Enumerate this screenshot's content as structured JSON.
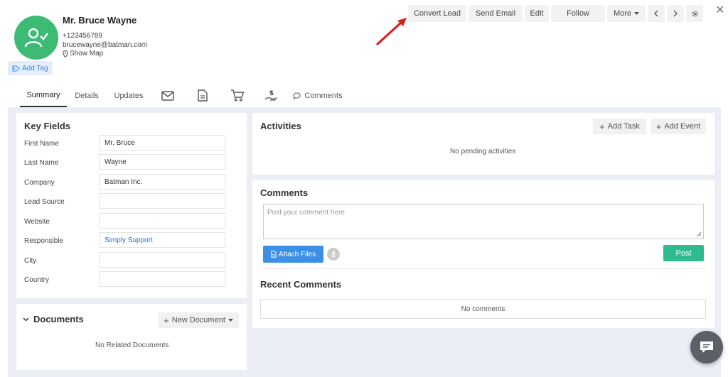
{
  "lead": {
    "name": "Mr. Bruce Wayne",
    "phone": "+123456789",
    "email": "brucewayne@batman.com",
    "map_label": "Show Map",
    "add_tag": "Add Tag"
  },
  "toolbar": {
    "convert_lead": "Convert Lead",
    "send_email": "Send Email",
    "edit": "Edit",
    "follow": "Follow",
    "more": "More",
    "close": "✕"
  },
  "tabs": {
    "summary": "Summary",
    "details": "Details",
    "updates": "Updates",
    "comments": "Comments"
  },
  "key_fields": {
    "title": "Key Fields",
    "rows": [
      {
        "label": "First Name",
        "value": "Mr. Bruce"
      },
      {
        "label": "Last Name",
        "value": "Wayne"
      },
      {
        "label": "Company",
        "value": "Batman Inc."
      },
      {
        "label": "Lead Source",
        "value": ""
      },
      {
        "label": "Website",
        "value": ""
      },
      {
        "label": "Responsible",
        "value": "Simply Support"
      },
      {
        "label": "City",
        "value": ""
      },
      {
        "label": "Country",
        "value": ""
      }
    ]
  },
  "documents": {
    "title": "Documents",
    "new_document": "New Document",
    "empty": "No Related Documents"
  },
  "activities": {
    "title": "Activities",
    "add_task": "Add Task",
    "add_event": "Add Event",
    "empty": "No pending activities"
  },
  "comments": {
    "title": "Comments",
    "placeholder": "Post your comment here",
    "attach_files": "Attach Files",
    "post": "Post",
    "recent_title": "Recent Comments",
    "empty": "No comments"
  },
  "colors": {
    "avatar": "#3dbb74",
    "attach": "#3c8fe6",
    "post": "#2fba8f",
    "link": "#2e6fd1",
    "arrow": "#e01b1b"
  }
}
